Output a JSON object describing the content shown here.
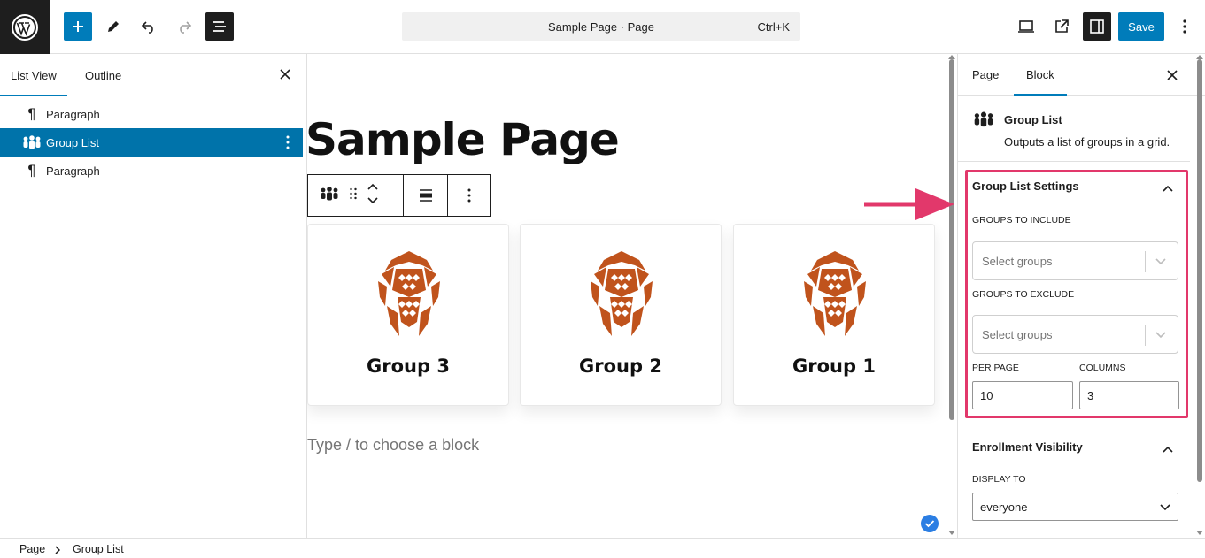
{
  "topbar": {
    "document_title": "Sample Page · Page",
    "shortcut": "Ctrl+K",
    "save_label": "Save"
  },
  "list_view": {
    "tabs": [
      {
        "label": "List View",
        "active": true
      },
      {
        "label": "Outline",
        "active": false
      }
    ],
    "items": [
      {
        "label": "Paragraph",
        "icon": "paragraph-icon",
        "selected": false
      },
      {
        "label": "Group List",
        "icon": "groups-icon",
        "selected": true
      },
      {
        "label": "Paragraph",
        "icon": "paragraph-icon",
        "selected": false
      }
    ]
  },
  "canvas": {
    "page_title": "Sample Page",
    "cards": [
      {
        "title": "Group 3"
      },
      {
        "title": "Group 2"
      },
      {
        "title": "Group 1"
      }
    ],
    "placeholder": "Type / to choose a block"
  },
  "sidebar": {
    "tabs": [
      {
        "label": "Page",
        "active": false
      },
      {
        "label": "Block",
        "active": true
      }
    ],
    "block": {
      "name": "Group List",
      "description": "Outputs a list of groups in a grid."
    },
    "group_list_settings": {
      "title": "Group List Settings",
      "groups_to_include_label": "GROUPS TO INCLUDE",
      "groups_to_include_placeholder": "Select groups",
      "groups_to_exclude_label": "GROUPS TO EXCLUDE",
      "groups_to_exclude_placeholder": "Select groups",
      "per_page_label": "PER PAGE",
      "per_page_value": "10",
      "columns_label": "COLUMNS",
      "columns_value": "3"
    },
    "enrollment_visibility": {
      "title": "Enrollment Visibility",
      "display_to_label": "DISPLAY TO",
      "display_to_value": "everyone"
    }
  },
  "breadcrumb": {
    "items": [
      "Page",
      "Group List"
    ]
  },
  "colors": {
    "accent": "#007cba",
    "highlight": "#e2386b",
    "logo": "#c0531c"
  }
}
